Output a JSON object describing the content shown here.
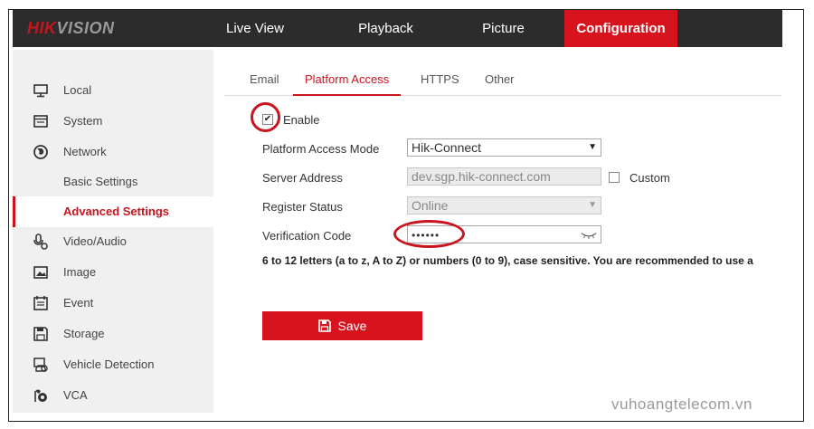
{
  "header": {
    "logo_part1": "HIK",
    "logo_part2": "VISION",
    "nav": [
      {
        "label": "Live View"
      },
      {
        "label": "Playback"
      },
      {
        "label": "Picture"
      },
      {
        "label": "Configuration"
      }
    ],
    "active_nav": "Configuration"
  },
  "sidebar": {
    "items": [
      {
        "label": "Local",
        "icon": "monitor-icon"
      },
      {
        "label": "System",
        "icon": "system-icon"
      },
      {
        "label": "Network",
        "icon": "globe-icon"
      },
      {
        "label": "Basic Settings",
        "icon": ""
      },
      {
        "label": "Advanced Settings",
        "icon": ""
      },
      {
        "label": "Video/Audio",
        "icon": "video-audio-icon"
      },
      {
        "label": "Image",
        "icon": "image-icon"
      },
      {
        "label": "Event",
        "icon": "event-icon"
      },
      {
        "label": "Storage",
        "icon": "storage-icon"
      },
      {
        "label": "Vehicle Detection",
        "icon": "vehicle-detection-icon"
      },
      {
        "label": "VCA",
        "icon": "vca-icon"
      }
    ],
    "active_item": "Advanced Settings"
  },
  "tabs": [
    {
      "label": "Email"
    },
    {
      "label": "Platform Access"
    },
    {
      "label": "HTTPS"
    },
    {
      "label": "Other"
    }
  ],
  "active_tab": "Platform Access",
  "form": {
    "enable_label": "Enable",
    "enable_checked": true,
    "platform_mode_label": "Platform Access Mode",
    "platform_mode_value": "Hik-Connect",
    "server_address_label": "Server Address",
    "server_address_value": "dev.sgp.hik-connect.com",
    "custom_label": "Custom",
    "custom_checked": false,
    "register_status_label": "Register Status",
    "register_status_value": "Online",
    "verification_code_label": "Verification Code",
    "verification_code_value": "••••••",
    "hint": "6 to 12 letters (a to z, A to Z) or numbers (0 to 9), case sensitive. You are recommended to use a",
    "save_label": "Save"
  },
  "watermark": "vuhoangtelecom.vn",
  "colors": {
    "accent": "#d7141e",
    "header_bg": "#2c2c2c",
    "sidebar_bg": "#f0f0f0"
  }
}
